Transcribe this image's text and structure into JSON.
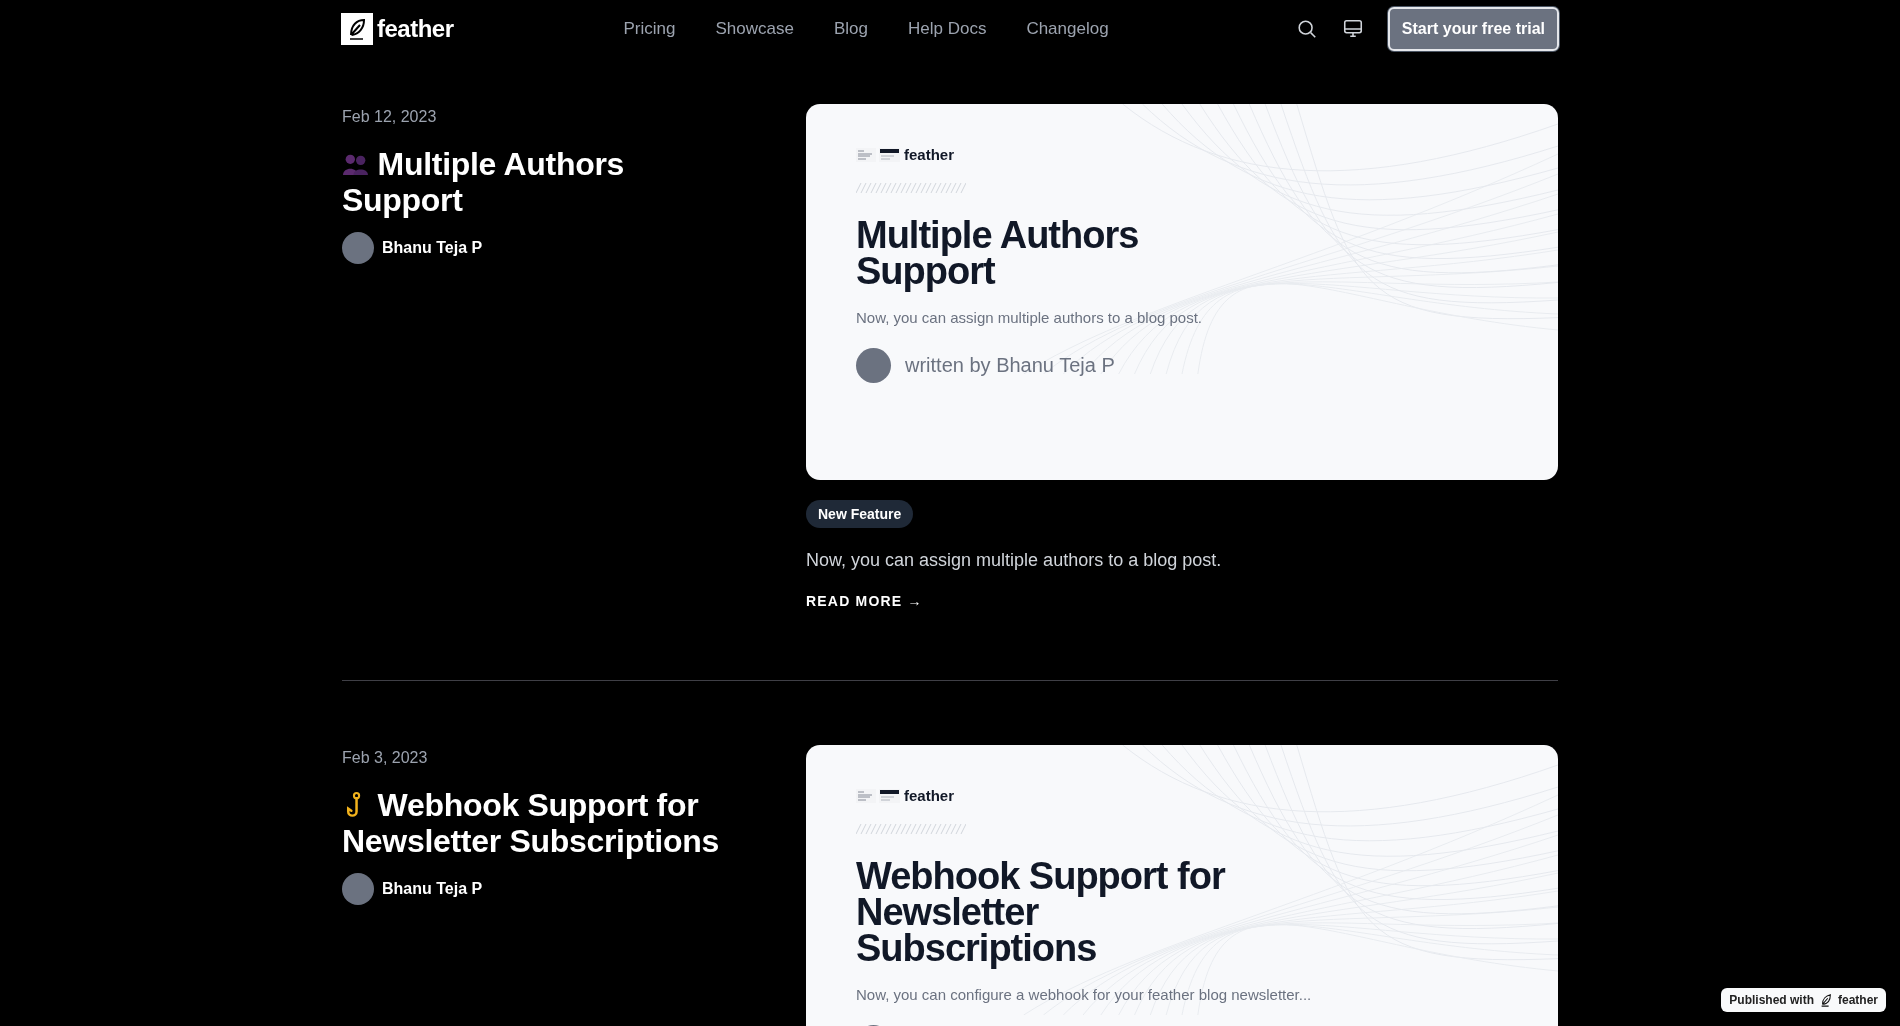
{
  "header": {
    "logo": "feather",
    "nav": [
      "Pricing",
      "Showcase",
      "Blog",
      "Help Docs",
      "Changelog"
    ],
    "cta": "Start your free trial"
  },
  "posts": [
    {
      "date": "Feb 12, 2023",
      "kind": "people",
      "title": "Multiple Authors Support",
      "author": "Bhanu Teja P",
      "card": {
        "brand": "feather",
        "title": "Multiple Authors Support",
        "description": "Now, you can assign multiple authors to a blog post.",
        "byline": "written by Bhanu Teja P"
      },
      "tag": "New Feature",
      "summary": "Now, you can assign multiple authors to a blog post.",
      "read_more": "READ MORE →"
    },
    {
      "date": "Feb 3, 2023",
      "kind": "hook",
      "title": "Webhook Support for Newsletter Subscriptions",
      "author": "Bhanu Teja P",
      "card": {
        "brand": "feather",
        "title": "Webhook Support for Newsletter Subscriptions",
        "description": "Now, you can configure a webhook for your feather blog newsletter..."
      }
    }
  ],
  "badge": {
    "prefix": "Published with",
    "brand": "feather"
  }
}
